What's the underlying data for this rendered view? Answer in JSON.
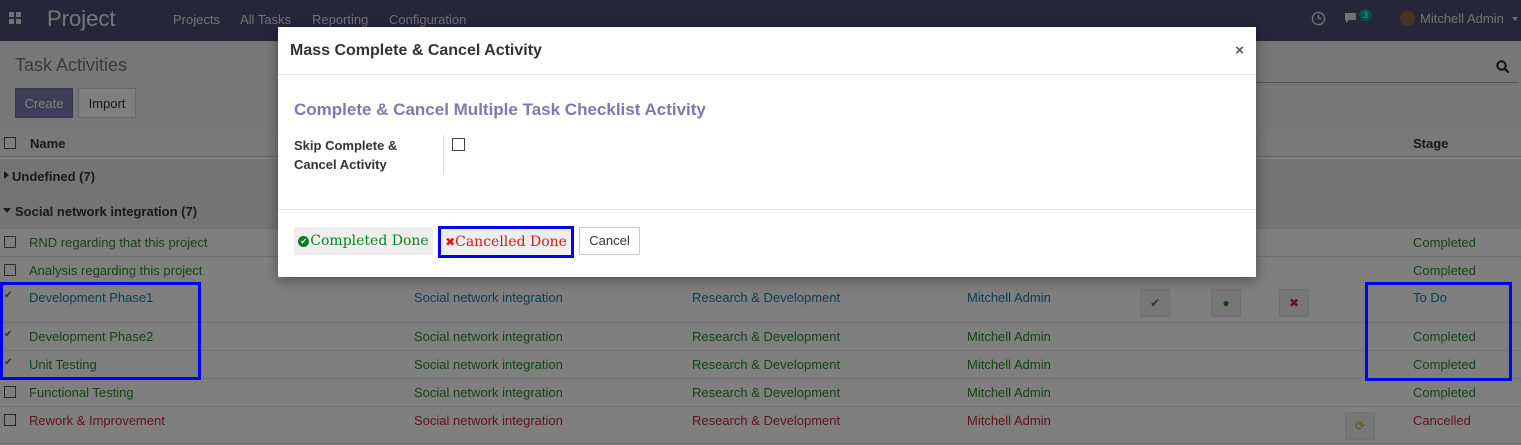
{
  "navbar": {
    "brand": "Project",
    "menu": [
      "Projects",
      "All Tasks",
      "Reporting",
      "Configuration"
    ],
    "chat_count": "3",
    "user": "Mitchell Admin"
  },
  "control_panel": {
    "breadcrumb": "Task Activities",
    "create_label": "Create",
    "import_label": "Import"
  },
  "list": {
    "headers": {
      "name": "Name",
      "stage": "Stage"
    },
    "groups": [
      {
        "label": "Undefined (7)"
      },
      {
        "label": "Social network integration (7)"
      }
    ],
    "rows": [
      {
        "name": "RND regarding that this project",
        "project": "",
        "team": "",
        "user": "",
        "stage": "Completed"
      },
      {
        "name": "Analysis regarding this project",
        "project": "",
        "team": "",
        "user": "",
        "stage": "Completed"
      },
      {
        "name": "Development Phase1",
        "project": "Social network integration",
        "team": "Research & Development",
        "user": "Mitchell Admin",
        "stage": "To Do"
      },
      {
        "name": "Development Phase2",
        "project": "Social network integration",
        "team": "Research & Development",
        "user": "Mitchell Admin",
        "stage": "Completed"
      },
      {
        "name": "Unit Testing",
        "project": "Social network integration",
        "team": "Research & Development",
        "user": "Mitchell Admin",
        "stage": "Completed"
      },
      {
        "name": "Functional Testing",
        "project": "Social network integration",
        "team": "Research & Development",
        "user": "Mitchell Admin",
        "stage": "Completed"
      },
      {
        "name": "Rework & Improvement",
        "project": "Social network integration",
        "team": "Research & Development",
        "user": "Mitchell Admin",
        "stage": "Cancelled"
      }
    ]
  },
  "modal": {
    "title": "Mass Complete & Cancel Activity",
    "close": "×",
    "form_title": "Complete & Cancel Multiple Task Checklist Activity",
    "field_label": "Skip Complete & Cancel Activity",
    "btn_completed": "Completed Done",
    "btn_cancelled": "Cancelled Done",
    "btn_cancel": "Cancel"
  },
  "colors": {
    "navbar": "#4d4a74",
    "accent": "#7c7bad",
    "completed_green": "#2a8a2a",
    "cancelled_red": "#c3283b",
    "highlight_blue": "#0000ee"
  }
}
